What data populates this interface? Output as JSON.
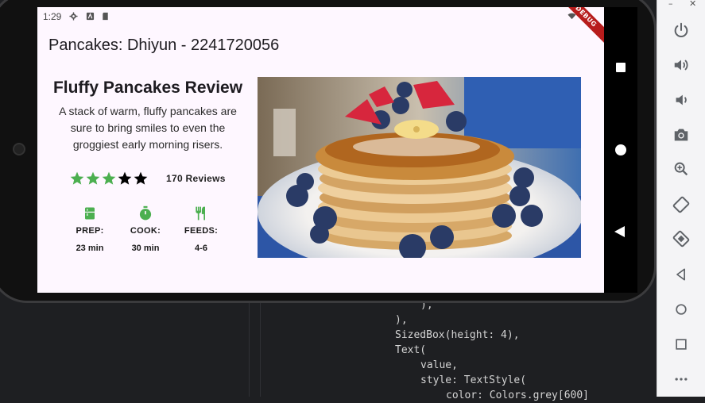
{
  "app": {
    "status_time": "1:29",
    "debug_banner": "DEBUG",
    "appbar_title": "Pancakes: Dhiyun - 2241720056"
  },
  "review": {
    "title": "Fluffy Pancakes Review",
    "description": "A stack of warm, fluffy pancakes are sure to bring smiles to even the groggiest early morning risers.",
    "stars_filled": 3,
    "stars_total": 5,
    "reviews_label": "170 Reviews",
    "star_color_filled": "#4caf50",
    "star_color_empty": "#000000"
  },
  "info": [
    {
      "icon": "kitchen-icon",
      "label": "PREP:",
      "value": "23 min"
    },
    {
      "icon": "timer-icon",
      "label": "COOK:",
      "value": "30 min"
    },
    {
      "icon": "restaurant-icon",
      "label": "FEEDS:",
      "value": "4-6"
    }
  ],
  "colors": {
    "accent_green": "#4caf50",
    "screen_bg": "#fef7ff"
  },
  "ide": {
    "lines": [
      "),",
      "),",
      "SizedBox(height: 4),",
      "Text(",
      "value,",
      "style: TextStyle(",
      "color: Colors.grey[600]"
    ]
  },
  "emulator_panel": {
    "icons": [
      "power-icon",
      "volume-up-icon",
      "volume-down-icon",
      "camera-icon",
      "zoom-icon",
      "rotate-left-icon",
      "rotate-right-icon",
      "back-icon",
      "home-icon",
      "overview-icon",
      "more-icon"
    ]
  }
}
